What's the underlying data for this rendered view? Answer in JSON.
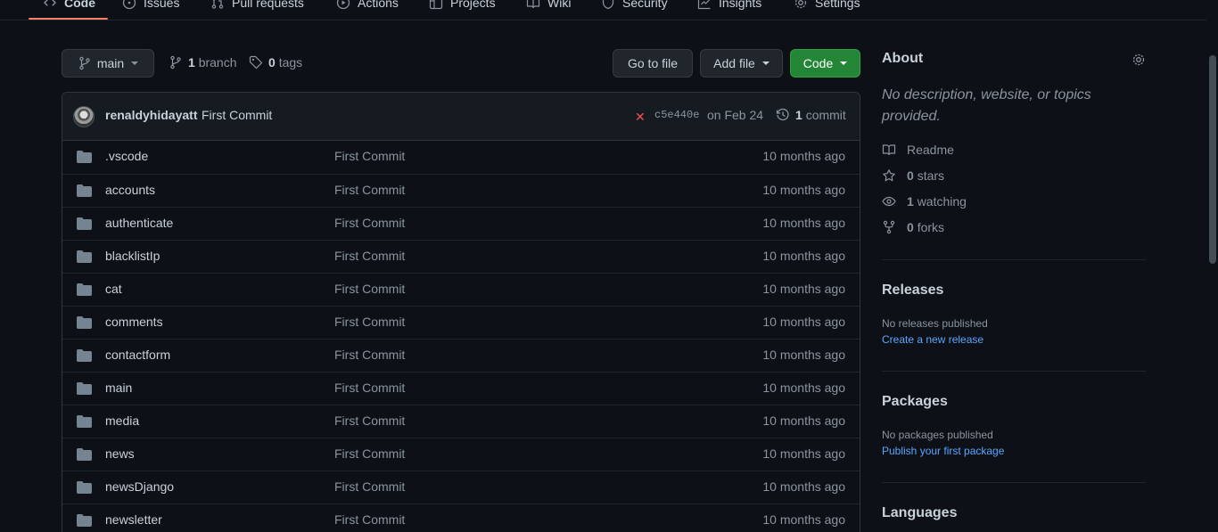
{
  "tabs": [
    {
      "label": "Code",
      "icon": "code-icon",
      "selected": true
    },
    {
      "label": "Issues",
      "icon": "issue-icon"
    },
    {
      "label": "Pull requests",
      "icon": "pull-request-icon"
    },
    {
      "label": "Actions",
      "icon": "play-icon"
    },
    {
      "label": "Projects",
      "icon": "table-icon"
    },
    {
      "label": "Wiki",
      "icon": "book-icon"
    },
    {
      "label": "Security",
      "icon": "shield-icon"
    },
    {
      "label": "Insights",
      "icon": "graph-icon"
    },
    {
      "label": "Settings",
      "icon": "gear-icon"
    }
  ],
  "toolbar": {
    "branch_label": "main",
    "branch_count": "1",
    "branch_word": "branch",
    "tag_count": "0",
    "tag_word": "tags",
    "go_to_file": "Go to file",
    "add_file": "Add file",
    "code": "Code"
  },
  "commit": {
    "author": "renaldyhidayatt",
    "message": "First Commit",
    "status": "✕",
    "sha": "c5e440e",
    "date": "on Feb 24",
    "count": "1",
    "count_word": "commit"
  },
  "files": [
    {
      "name": ".vscode",
      "message": "First Commit",
      "age": "10 months ago"
    },
    {
      "name": "accounts",
      "message": "First Commit",
      "age": "10 months ago"
    },
    {
      "name": "authenticate",
      "message": "First Commit",
      "age": "10 months ago"
    },
    {
      "name": "blacklistIp",
      "message": "First Commit",
      "age": "10 months ago"
    },
    {
      "name": "cat",
      "message": "First Commit",
      "age": "10 months ago"
    },
    {
      "name": "comments",
      "message": "First Commit",
      "age": "10 months ago"
    },
    {
      "name": "contactform",
      "message": "First Commit",
      "age": "10 months ago"
    },
    {
      "name": "main",
      "message": "First Commit",
      "age": "10 months ago"
    },
    {
      "name": "media",
      "message": "First Commit",
      "age": "10 months ago"
    },
    {
      "name": "news",
      "message": "First Commit",
      "age": "10 months ago"
    },
    {
      "name": "newsDjango",
      "message": "First Commit",
      "age": "10 months ago"
    },
    {
      "name": "newsletter",
      "message": "First Commit",
      "age": "10 months ago"
    }
  ],
  "about": {
    "title": "About",
    "description": "No description, website, or topics provided.",
    "readme": "Readme",
    "stars_count": "0",
    "stars_word": "stars",
    "watching_count": "1",
    "watching_word": "watching",
    "forks_count": "0",
    "forks_word": "forks"
  },
  "releases": {
    "title": "Releases",
    "empty": "No releases published",
    "link": "Create a new release"
  },
  "packages": {
    "title": "Packages",
    "empty": "No packages published",
    "link": "Publish your first package"
  },
  "languages": {
    "title": "Languages"
  },
  "colors": {
    "background": "#0d1117",
    "accent_underline": "#f78166",
    "primary_button": "#238636",
    "link": "#58a6ff",
    "status_fail": "#f85149"
  }
}
